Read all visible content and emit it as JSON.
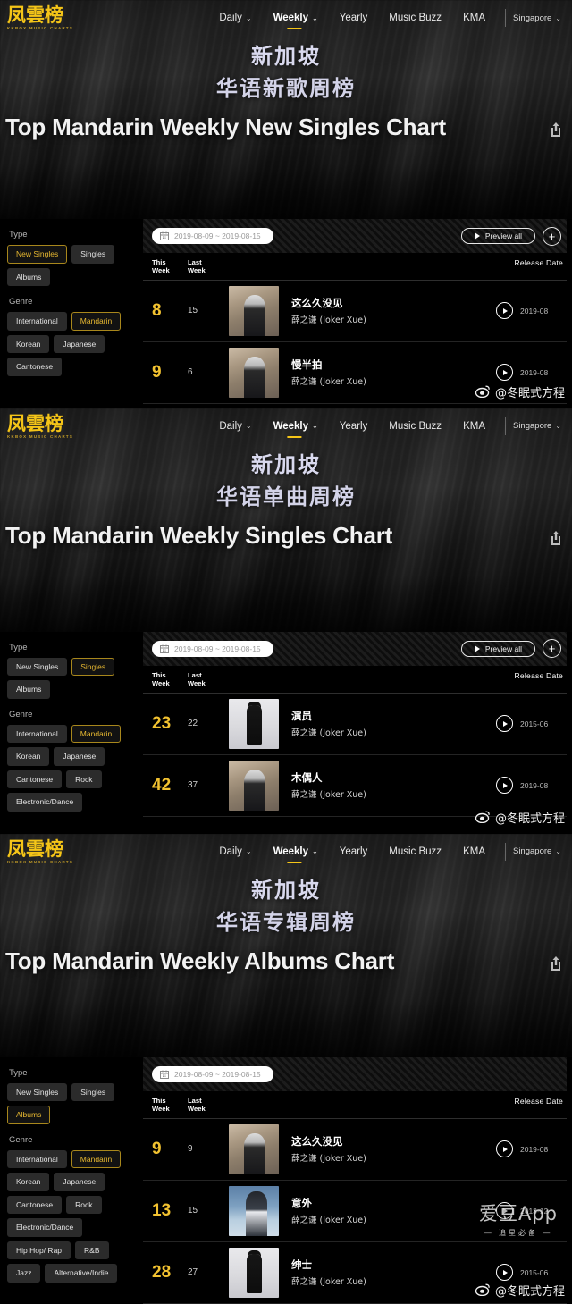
{
  "nav": {
    "logo_mark": "凤雲榜",
    "logo_sub": "KKBOX MUSIC CHARTS",
    "items": [
      {
        "label": "Daily",
        "caret": "⌄",
        "active": false
      },
      {
        "label": "Weekly",
        "caret": "⌄",
        "active": true
      },
      {
        "label": "Yearly",
        "caret": "",
        "active": false
      },
      {
        "label": "Music Buzz",
        "caret": "",
        "active": false
      },
      {
        "label": "KMA",
        "caret": "",
        "active": false
      }
    ],
    "region": "Singapore",
    "region_caret": "⌄"
  },
  "colors": {
    "accent_yellow": "#F5C518",
    "rank_yellow": "#F2C230",
    "chip_selected_text": "#E8B931",
    "chip_selected_border": "#A8871C",
    "hero_cn_text": "#D9D9EE"
  },
  "toolbar": {
    "date_range": "2019-08-09 ~ 2019-08-15",
    "calendar_icon": "calendar-icon",
    "preview_label": "Preview all",
    "add_label": "+"
  },
  "table_headers": {
    "this_week_line1": "This",
    "this_week_line2": "Week",
    "last_week_line1": "Last",
    "last_week_line2": "Week",
    "release_date": "Release Date"
  },
  "filters": {
    "type_label": "Type",
    "genre_label": "Genre"
  },
  "watermarks": {
    "weibo_handle": "@冬眠式方程",
    "idol_main": "爱豆App",
    "idol_sub": "— 追星必备 —"
  },
  "panels": [
    {
      "hero": {
        "cn_line1": "新加坡",
        "cn_line2": "华语新歌周榜",
        "en_title": "Top Mandarin Weekly New Singles Chart",
        "share_icon": "share-icon"
      },
      "type_chips": [
        {
          "label": "New Singles",
          "selected": true
        },
        {
          "label": "Singles",
          "selected": false
        },
        {
          "label": "Albums",
          "selected": false
        }
      ],
      "genre_chips": [
        {
          "label": "International",
          "selected": false
        },
        {
          "label": "Mandarin",
          "selected": true
        },
        {
          "label": "Korean",
          "selected": false
        },
        {
          "label": "Japanese",
          "selected": false
        },
        {
          "label": "Cantonese",
          "selected": false
        }
      ],
      "has_preview": true,
      "rows": [
        {
          "this_week": "8",
          "last_week": "15",
          "song": "这么久没见",
          "artist": "薛之谦 (Joker Xue)",
          "release": "2019-08",
          "cover": "cv-street"
        },
        {
          "this_week": "9",
          "last_week": "6",
          "song": "慢半拍",
          "artist": "薛之谦 (Joker Xue)",
          "release": "2019-08",
          "cover": "cv-street"
        }
      ]
    },
    {
      "hero": {
        "cn_line1": "新加坡",
        "cn_line2": "华语单曲周榜",
        "en_title": "Top Mandarin Weekly Singles Chart",
        "share_icon": "share-icon"
      },
      "type_chips": [
        {
          "label": "New Singles",
          "selected": false
        },
        {
          "label": "Singles",
          "selected": true
        },
        {
          "label": "Albums",
          "selected": false
        }
      ],
      "genre_chips": [
        {
          "label": "International",
          "selected": false
        },
        {
          "label": "Mandarin",
          "selected": true
        },
        {
          "label": "Korean",
          "selected": false
        },
        {
          "label": "Japanese",
          "selected": false
        },
        {
          "label": "Cantonese",
          "selected": false
        },
        {
          "label": "Rock",
          "selected": false
        },
        {
          "label": "Electronic/Dance",
          "selected": false
        }
      ],
      "has_preview": true,
      "rows": [
        {
          "this_week": "23",
          "last_week": "22",
          "song": "演员",
          "artist": "薛之谦 (Joker Xue)",
          "release": "2015-06",
          "cover": "cv-suit"
        },
        {
          "this_week": "42",
          "last_week": "37",
          "song": "木偶人",
          "artist": "薛之谦 (Joker Xue)",
          "release": "2019-08",
          "cover": "cv-street"
        }
      ]
    },
    {
      "hero": {
        "cn_line1": "新加坡",
        "cn_line2": "华语专辑周榜",
        "en_title": "Top Mandarin Weekly Albums Chart",
        "share_icon": "share-icon"
      },
      "type_chips": [
        {
          "label": "New Singles",
          "selected": false
        },
        {
          "label": "Singles",
          "selected": false
        },
        {
          "label": "Albums",
          "selected": true
        }
      ],
      "genre_chips": [
        {
          "label": "International",
          "selected": false
        },
        {
          "label": "Mandarin",
          "selected": true
        },
        {
          "label": "Korean",
          "selected": false
        },
        {
          "label": "Japanese",
          "selected": false
        },
        {
          "label": "Cantonese",
          "selected": false
        },
        {
          "label": "Rock",
          "selected": false
        },
        {
          "label": "Electronic/Dance",
          "selected": false
        },
        {
          "label": "Hip Hop/ Rap",
          "selected": false
        },
        {
          "label": "R&B",
          "selected": false
        },
        {
          "label": "Jazz",
          "selected": false
        },
        {
          "label": "Alternative/Indie",
          "selected": false
        }
      ],
      "has_preview": false,
      "rows": [
        {
          "this_week": "9",
          "last_week": "9",
          "song": "这么久没见",
          "artist": "薛之谦 (Joker Xue)",
          "release": "2019-08",
          "cover": "cv-street"
        },
        {
          "this_week": "13",
          "last_week": "15",
          "song": "意外",
          "artist": "薛之谦 (Joker Xue)",
          "release": "2013-12",
          "cover": "cv-sea"
        },
        {
          "this_week": "28",
          "last_week": "27",
          "song": "绅士",
          "artist": "薛之谦 (Joker Xue)",
          "release": "2015-06",
          "cover": "cv-suit"
        }
      ]
    }
  ]
}
